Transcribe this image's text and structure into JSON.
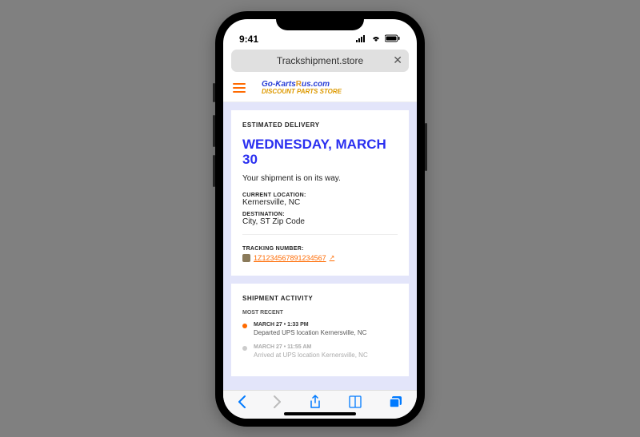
{
  "status_bar": {
    "time": "9:41"
  },
  "browser": {
    "url": "Trackshipment.store"
  },
  "logo": {
    "line1_pre": "Go-Karts",
    "line1_r": "R",
    "line1_post": "us.com",
    "line2": "DISCOUNT PARTS STORE"
  },
  "delivery": {
    "section_label": "ESTIMATED DELIVERY",
    "date": "WEDNESDAY, MARCH 30",
    "status": "Your shipment is on its way.",
    "current_location_label": "CURRENT LOCATION:",
    "current_location": "Kernersville, NC",
    "destination_label": "DESTINATION:",
    "destination": "City, ST Zip Code",
    "tracking_label": "TRACKING NUMBER:",
    "tracking_number": "1Z1234567891234567"
  },
  "activity": {
    "section_label": "SHIPMENT ACTIVITY",
    "sub_label": "MOST RECENT",
    "items": [
      {
        "time": "MARCH 27 • 1:33 PM",
        "desc": "Departed UPS location Kernersville, NC"
      },
      {
        "time": "MARCH 27 • 11:55 AM",
        "desc": "Arrived at UPS location Kernersville, NC"
      }
    ]
  }
}
